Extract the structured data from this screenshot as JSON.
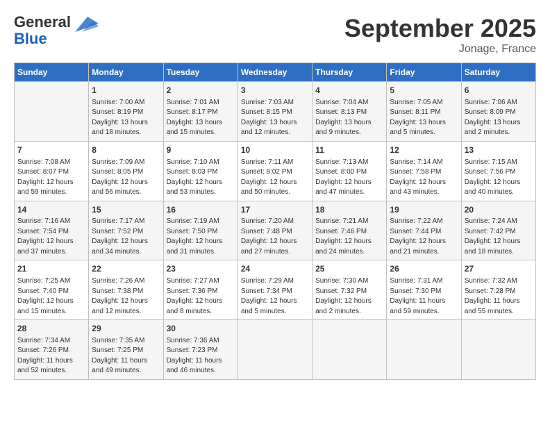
{
  "logo": {
    "general": "General",
    "blue": "Blue"
  },
  "title": {
    "month_year": "September 2025",
    "location": "Jonage, France"
  },
  "weekdays": [
    "Sunday",
    "Monday",
    "Tuesday",
    "Wednesday",
    "Thursday",
    "Friday",
    "Saturday"
  ],
  "weeks": [
    [
      {
        "day": "",
        "info": ""
      },
      {
        "day": "1",
        "info": "Sunrise: 7:00 AM\nSunset: 8:19 PM\nDaylight: 13 hours\nand 18 minutes."
      },
      {
        "day": "2",
        "info": "Sunrise: 7:01 AM\nSunset: 8:17 PM\nDaylight: 13 hours\nand 15 minutes."
      },
      {
        "day": "3",
        "info": "Sunrise: 7:03 AM\nSunset: 8:15 PM\nDaylight: 13 hours\nand 12 minutes."
      },
      {
        "day": "4",
        "info": "Sunrise: 7:04 AM\nSunset: 8:13 PM\nDaylight: 13 hours\nand 9 minutes."
      },
      {
        "day": "5",
        "info": "Sunrise: 7:05 AM\nSunset: 8:11 PM\nDaylight: 13 hours\nand 5 minutes."
      },
      {
        "day": "6",
        "info": "Sunrise: 7:06 AM\nSunset: 8:09 PM\nDaylight: 13 hours\nand 2 minutes."
      }
    ],
    [
      {
        "day": "7",
        "info": "Sunrise: 7:08 AM\nSunset: 8:07 PM\nDaylight: 12 hours\nand 59 minutes."
      },
      {
        "day": "8",
        "info": "Sunrise: 7:09 AM\nSunset: 8:05 PM\nDaylight: 12 hours\nand 56 minutes."
      },
      {
        "day": "9",
        "info": "Sunrise: 7:10 AM\nSunset: 8:03 PM\nDaylight: 12 hours\nand 53 minutes."
      },
      {
        "day": "10",
        "info": "Sunrise: 7:11 AM\nSunset: 8:02 PM\nDaylight: 12 hours\nand 50 minutes."
      },
      {
        "day": "11",
        "info": "Sunrise: 7:13 AM\nSunset: 8:00 PM\nDaylight: 12 hours\nand 47 minutes."
      },
      {
        "day": "12",
        "info": "Sunrise: 7:14 AM\nSunset: 7:58 PM\nDaylight: 12 hours\nand 43 minutes."
      },
      {
        "day": "13",
        "info": "Sunrise: 7:15 AM\nSunset: 7:56 PM\nDaylight: 12 hours\nand 40 minutes."
      }
    ],
    [
      {
        "day": "14",
        "info": "Sunrise: 7:16 AM\nSunset: 7:54 PM\nDaylight: 12 hours\nand 37 minutes."
      },
      {
        "day": "15",
        "info": "Sunrise: 7:17 AM\nSunset: 7:52 PM\nDaylight: 12 hours\nand 34 minutes."
      },
      {
        "day": "16",
        "info": "Sunrise: 7:19 AM\nSunset: 7:50 PM\nDaylight: 12 hours\nand 31 minutes."
      },
      {
        "day": "17",
        "info": "Sunrise: 7:20 AM\nSunset: 7:48 PM\nDaylight: 12 hours\nand 27 minutes."
      },
      {
        "day": "18",
        "info": "Sunrise: 7:21 AM\nSunset: 7:46 PM\nDaylight: 12 hours\nand 24 minutes."
      },
      {
        "day": "19",
        "info": "Sunrise: 7:22 AM\nSunset: 7:44 PM\nDaylight: 12 hours\nand 21 minutes."
      },
      {
        "day": "20",
        "info": "Sunrise: 7:24 AM\nSunset: 7:42 PM\nDaylight: 12 hours\nand 18 minutes."
      }
    ],
    [
      {
        "day": "21",
        "info": "Sunrise: 7:25 AM\nSunset: 7:40 PM\nDaylight: 12 hours\nand 15 minutes."
      },
      {
        "day": "22",
        "info": "Sunrise: 7:26 AM\nSunset: 7:38 PM\nDaylight: 12 hours\nand 12 minutes."
      },
      {
        "day": "23",
        "info": "Sunrise: 7:27 AM\nSunset: 7:36 PM\nDaylight: 12 hours\nand 8 minutes."
      },
      {
        "day": "24",
        "info": "Sunrise: 7:29 AM\nSunset: 7:34 PM\nDaylight: 12 hours\nand 5 minutes."
      },
      {
        "day": "25",
        "info": "Sunrise: 7:30 AM\nSunset: 7:32 PM\nDaylight: 12 hours\nand 2 minutes."
      },
      {
        "day": "26",
        "info": "Sunrise: 7:31 AM\nSunset: 7:30 PM\nDaylight: 11 hours\nand 59 minutes."
      },
      {
        "day": "27",
        "info": "Sunrise: 7:32 AM\nSunset: 7:28 PM\nDaylight: 11 hours\nand 55 minutes."
      }
    ],
    [
      {
        "day": "28",
        "info": "Sunrise: 7:34 AM\nSunset: 7:26 PM\nDaylight: 11 hours\nand 52 minutes."
      },
      {
        "day": "29",
        "info": "Sunrise: 7:35 AM\nSunset: 7:25 PM\nDaylight: 11 hours\nand 49 minutes."
      },
      {
        "day": "30",
        "info": "Sunrise: 7:36 AM\nSunset: 7:23 PM\nDaylight: 11 hours\nand 46 minutes."
      },
      {
        "day": "",
        "info": ""
      },
      {
        "day": "",
        "info": ""
      },
      {
        "day": "",
        "info": ""
      },
      {
        "day": "",
        "info": ""
      }
    ]
  ]
}
